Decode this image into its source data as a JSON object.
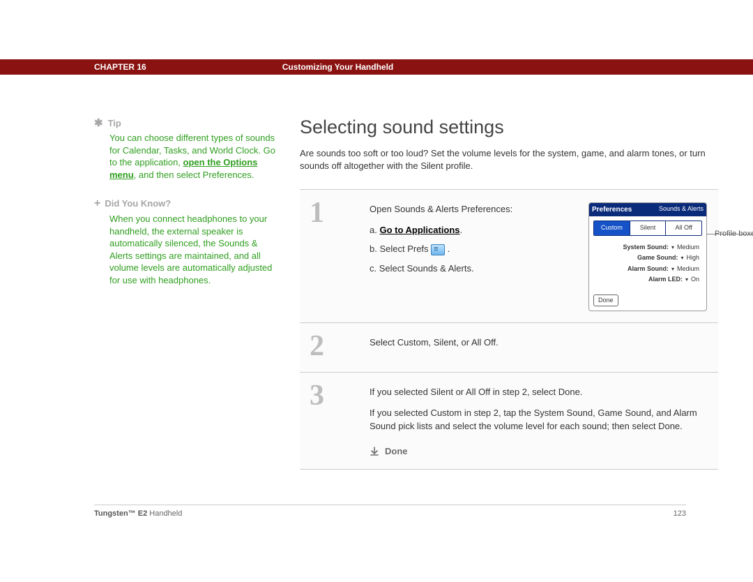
{
  "header": {
    "chapter_label": "CHAPTER 16",
    "section_title": "Customizing Your Handheld"
  },
  "sidebar": {
    "tip": {
      "heading": "Tip",
      "body_pre": "You can choose different types of sounds for Calendar, Tasks, and World Clock. Go to the application, ",
      "link": "open the Options menu",
      "body_post": ", and then select Preferences."
    },
    "dyk": {
      "heading": "Did You Know?",
      "body": "When you connect headphones to your handheld, the external speaker is automatically silenced, the Sounds & Alerts settings are maintained, and all volume levels are automatically adjusted for use with headphones."
    }
  },
  "main": {
    "title": "Selecting sound settings",
    "intro": "Are sounds too soft or too loud? Set the volume levels for the system, game, and alarm tones, or turn sounds off altogether with the Silent profile.",
    "steps": [
      {
        "num": "1",
        "intro": "Open Sounds & Alerts Preferences:",
        "a_prefix": "a.  ",
        "a_link": "Go to Applications",
        "a_suffix": ".",
        "b_prefix": "b.  Select Prefs ",
        "b_suffix": " .",
        "c": "c.  Select Sounds & Alerts."
      },
      {
        "num": "2",
        "text": "Select Custom, Silent, or All Off."
      },
      {
        "num": "3",
        "p1": "If you selected Silent or All Off in step 2, select Done.",
        "p2": "If you selected Custom in step 2, tap the System Sound, Game Sound, and Alarm Sound pick lists and select the volume level for each sound; then select Done.",
        "done": "Done"
      }
    ]
  },
  "device": {
    "title_left": "Preferences",
    "title_right": "Sounds & Alerts",
    "tabs": [
      "Custom",
      "Silent",
      "All Off"
    ],
    "rows": [
      {
        "k": "System Sound:",
        "v": "Medium"
      },
      {
        "k": "Game Sound:",
        "v": "High"
      },
      {
        "k": "Alarm Sound:",
        "v": "Medium"
      },
      {
        "k": "Alarm LED:",
        "v": "On"
      }
    ],
    "done_btn": "Done",
    "callout": "Profile boxes"
  },
  "footer": {
    "product_bold": "Tungsten™ E2",
    "product_rest": " Handheld",
    "page": "123"
  }
}
